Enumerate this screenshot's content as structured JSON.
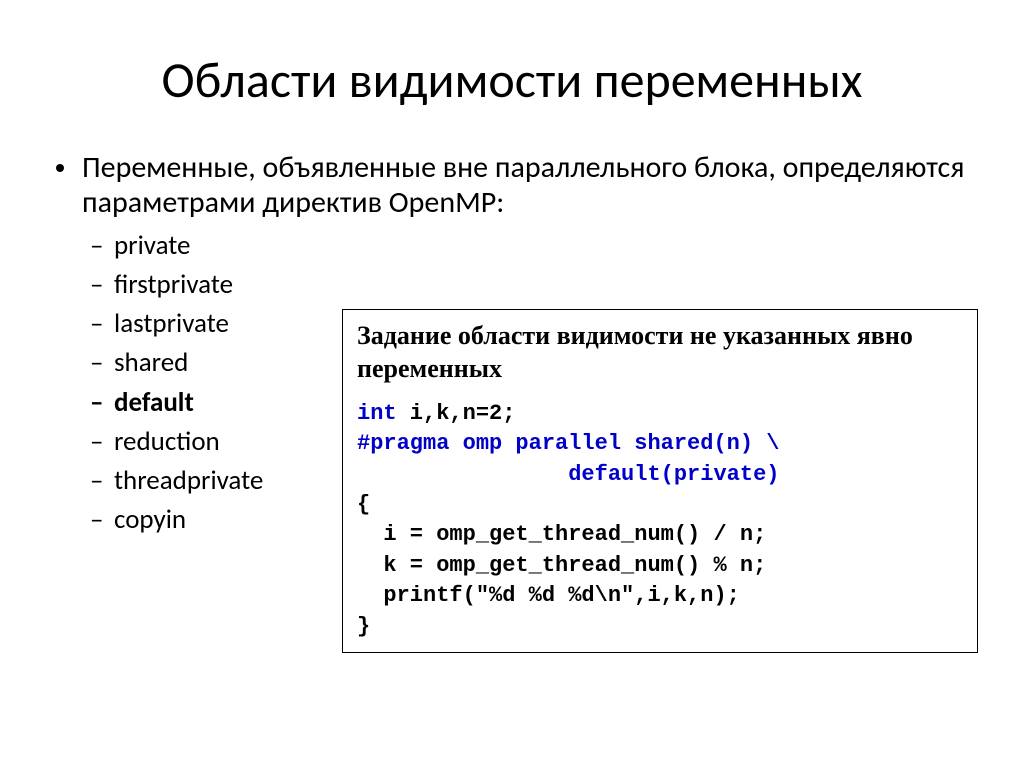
{
  "title": "Области видимости переменных",
  "main_point": "Переменные, объявленные вне параллельного блока, определяются параметрами директив OpenMP:",
  "sub_items": {
    "a": "private",
    "b": "firstprivate",
    "c": "lastprivate",
    "d": "shared",
    "e": "default",
    "f": "reduction",
    "g": "threadprivate",
    "h": "copyin"
  },
  "box_title": "Задание области видимости не указанных явно переменных",
  "code": {
    "kw_int": "int",
    "decl_rest": " i,k,n=2;",
    "pragma_l1": "#pragma omp parallel shared(n) \\",
    "pragma_l2": "                default(private)",
    "brace_open": "{",
    "line_i": "  i = omp_get_thread_num() / n;",
    "line_k": "  k = omp_get_thread_num() % n;",
    "line_print": "  printf(\"%d %d %d\\n\",i,k,n);",
    "brace_close": "}"
  }
}
